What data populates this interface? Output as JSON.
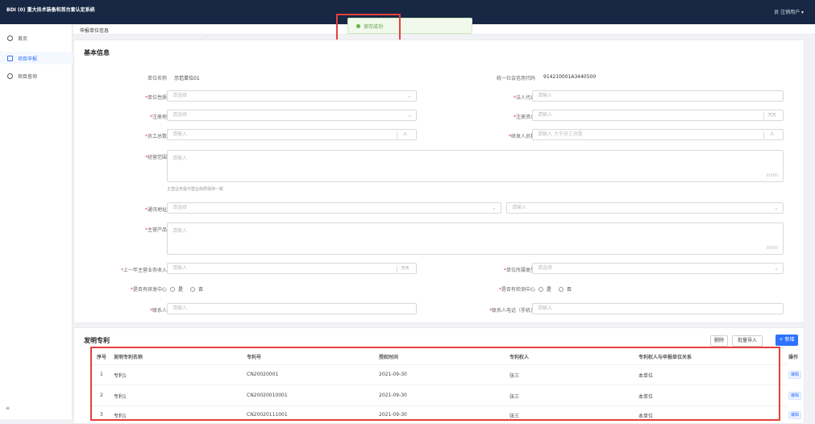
{
  "app": {
    "title": "BDI (0) 重大技术装备和首台套认定系统",
    "user": "员 注销用户 ▾",
    "toast": "保存成功",
    "tab_current": "申报单位信息"
  },
  "sidebar": {
    "items": [
      {
        "label": "首页",
        "icon": "home-icon"
      },
      {
        "label": "项目申报",
        "icon": "file-icon"
      },
      {
        "label": "项目查询",
        "icon": "search-icon"
      }
    ],
    "collapse_icon": "≡"
  },
  "colors": {
    "topbar": "#172744",
    "accent": "#2f72ff",
    "highlight": "#e5403c",
    "toast_bg": "#f0f9eb"
  },
  "basic_info": {
    "section_title": "基本信息",
    "unit_name_label": "单位名称",
    "unit_name_value": "示范单位01",
    "credit_code_label": "统一社会信用代码",
    "credit_code_value": "914210001A3440500",
    "unit_type_label": "单位性质",
    "unit_type_placeholder": "请选择",
    "legal_rep_label": "法人代表",
    "legal_rep_placeholder": "请输入",
    "registry_label": "注册地",
    "registry_placeholder": "请选择",
    "reg_capital_label": "注册资本",
    "reg_capital_placeholder": "请输入",
    "reg_capital_suffix": "万元",
    "employees_label": "员工总数",
    "employees_placeholder": "请输入",
    "employees_suffix": "人",
    "rd_staff_label": "研发人员数",
    "rd_staff_placeholder": "请输入 大于员工总数",
    "business_label": "经营范围",
    "business_placeholder": "请输入",
    "business_count": "0/500",
    "business_hint": "主营业务需与营业执照保持一致",
    "address_label": "通讯地址",
    "address_placeholder": "请选择",
    "address_detail_placeholder": "请输入",
    "products_label": "主营产品",
    "products_placeholder": "请输入",
    "products_count": "0/500",
    "revenue_label": "上一年主营业务收入",
    "revenue_placeholder": "请输入",
    "revenue_suffix": "万元",
    "type_label": "单位所属类型",
    "type_placeholder": "请选择",
    "rd_center_label": "是否有研发中心",
    "test_center_label": "是否有检测中心",
    "yes": "是",
    "no": "否",
    "contact_label": "联系人",
    "contact_placeholder": "请输入",
    "phone_label": "联系人电话（手机）",
    "phone_placeholder": "请输入"
  },
  "patents": {
    "section_title": "发明专利",
    "btn_delete": "删除",
    "btn_clear": "批量导入",
    "btn_add": "+ 新增",
    "columns": [
      "序号",
      "发明专利名称",
      "专利号",
      "授权时间",
      "专利权人",
      "专利权人与申报单位关系",
      "操作"
    ],
    "rows": [
      {
        "no": "1",
        "name": "专利1",
        "number": "CN20020001",
        "date": "2021-09-30",
        "owner": "张三",
        "relation": "本单位",
        "action": "编辑"
      },
      {
        "no": "2",
        "name": "专利1",
        "number": "CN20020010001",
        "date": "2021-09-30",
        "owner": "张三",
        "relation": "本单位",
        "action": "编辑"
      },
      {
        "no": "3",
        "name": "专利1",
        "number": "CN20020111001",
        "date": "2021-09-30",
        "owner": "张三",
        "relation": "本单位",
        "action": "编辑"
      }
    ]
  }
}
